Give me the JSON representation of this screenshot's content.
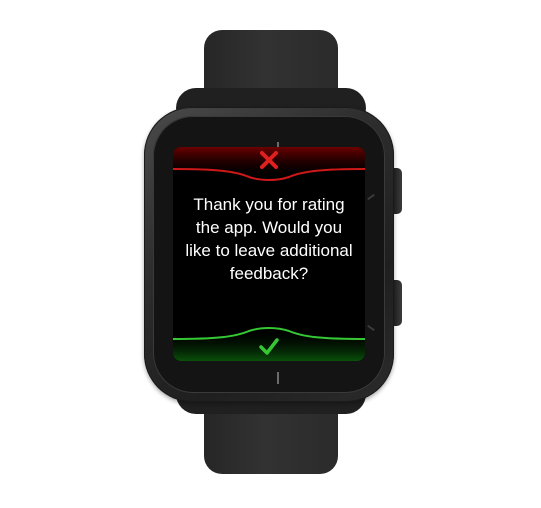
{
  "prompt": {
    "message": "Thank you for rating the app. Would you like to leave additional feedback?"
  },
  "actions": {
    "cancel_icon": "close-icon",
    "confirm_icon": "checkmark-icon"
  },
  "colors": {
    "cancel": "#e0201f",
    "confirm": "#35c734",
    "screen_background": "#000000",
    "text": "#ffffff"
  }
}
